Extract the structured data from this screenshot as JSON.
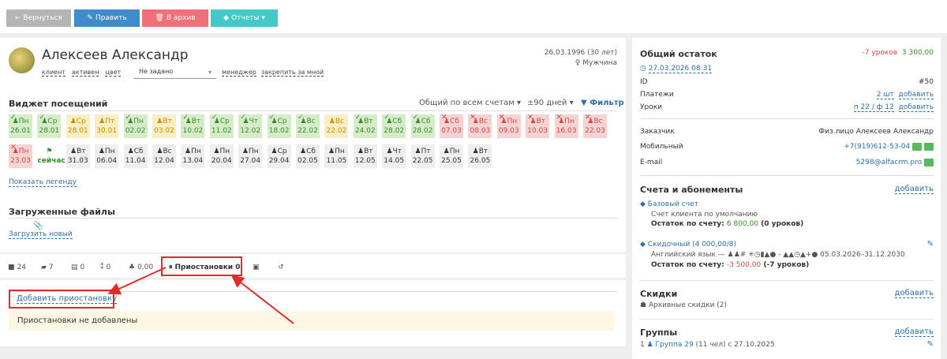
{
  "toolbar": {
    "back": "← Вернуться",
    "edit": "Править",
    "archive": "В архив",
    "reports": "Отчеты ▾"
  },
  "student": {
    "name": "Алексеев Александр",
    "birth": "26.03.1996 (30 лет)",
    "gender": "Мужчина",
    "tags": [
      "клиент",
      "активен",
      "цвет"
    ],
    "color_select": "Не задано",
    "manager": "менеджер",
    "pin": "закрепить за мной"
  },
  "visits": {
    "title": "Виджет посещений",
    "scope": "Общий по всем счетам ▾",
    "range": "±90 дней ▾",
    "filter": "Фильтр",
    "row1": [
      {
        "w": "Пн",
        "d": "26.01",
        "s": "g"
      },
      {
        "w": "Ср",
        "d": "28.01",
        "s": "g"
      },
      {
        "w": "Ср",
        "d": "28.01",
        "s": "y"
      },
      {
        "w": "Пт",
        "d": "30.01",
        "s": "y"
      },
      {
        "w": "Пн",
        "d": "02.02",
        "s": "g"
      },
      {
        "w": "Вт",
        "d": "03.02",
        "s": "y"
      },
      {
        "w": "Вт",
        "d": "10.02",
        "s": "g"
      },
      {
        "w": "Ср",
        "d": "11.02",
        "s": "g"
      },
      {
        "w": "Чт",
        "d": "12.02",
        "s": "g"
      },
      {
        "w": "Ср",
        "d": "18.02",
        "s": "g"
      },
      {
        "w": "Вс",
        "d": "22.02",
        "s": "g"
      },
      {
        "w": "Вс",
        "d": "22.02",
        "s": "y"
      },
      {
        "w": "Вт",
        "d": "24.02",
        "s": "g"
      },
      {
        "w": "Сб",
        "d": "28.02",
        "s": "g"
      },
      {
        "w": "Сб",
        "d": "28.02",
        "s": "g"
      },
      {
        "w": "Сб",
        "d": "07.03",
        "s": "r"
      },
      {
        "w": "Вс",
        "d": "08.03",
        "s": "r"
      },
      {
        "w": "Пн",
        "d": "09.03",
        "s": "r"
      },
      {
        "w": "Вт",
        "d": "10.03",
        "s": "r"
      },
      {
        "w": "Пн",
        "d": "16.03",
        "s": "r"
      },
      {
        "w": "Вс",
        "d": "22.03",
        "s": "r"
      }
    ],
    "row2": [
      {
        "w": "Пн",
        "d": "23.03",
        "s": "r"
      },
      {
        "w": "",
        "d": "сейчас",
        "s": "now"
      },
      {
        "w": "Вт",
        "d": "31.03",
        "s": "n"
      },
      {
        "w": "Пн",
        "d": "06.04",
        "s": "n"
      },
      {
        "w": "Сб",
        "d": "11.04",
        "s": "n"
      },
      {
        "w": "Вс",
        "d": "12.04",
        "s": "n"
      },
      {
        "w": "Пн",
        "d": "13.04",
        "s": "n"
      },
      {
        "w": "Пн",
        "d": "20.04",
        "s": "n"
      },
      {
        "w": "Пн",
        "d": "27.04",
        "s": "n"
      },
      {
        "w": "Ср",
        "d": "29.04",
        "s": "n"
      },
      {
        "w": "Сб",
        "d": "02.05",
        "s": "n"
      },
      {
        "w": "Пн",
        "d": "11.05",
        "s": "n"
      },
      {
        "w": "Вт",
        "d": "12.05",
        "s": "n"
      },
      {
        "w": "Чт",
        "d": "14.05",
        "s": "n"
      },
      {
        "w": "Пт",
        "d": "22.05",
        "s": "n"
      },
      {
        "w": "Пн",
        "d": "25.05",
        "s": "n"
      },
      {
        "w": "Вт",
        "d": "26.05",
        "s": "n"
      }
    ],
    "legend": "Показать легенду"
  },
  "files": {
    "title": "Загруженные файлы",
    "upload": "Загрузить новый"
  },
  "tabs": {
    "t1": "24",
    "t2": "7",
    "t3": "0",
    "t4": "0",
    "t5": "0,00",
    "pauses": "Приостановки 0"
  },
  "pauses": {
    "add": "Добавить приостановку",
    "empty": "Приостановки не добавлены"
  },
  "right": {
    "balance_title": "Общий остаток",
    "balance_lessons": "-7 уроков",
    "balance_money": "3 300,00",
    "balance_date": "27.03.2026 08:31",
    "id_label": "ID",
    "id_value": "#50",
    "payments_label": "Платежи",
    "payments_value": "2 шт",
    "add": "добавить",
    "lessons_label": "Уроки",
    "lessons_value": "п 22 / ф 12",
    "customer_label": "Заказчик",
    "customer_value": "Физ.лицо Алексеев Александр",
    "mobile_label": "Мобильный",
    "mobile_value": "+7(919)612-53-04",
    "email_label": "E-mail",
    "email_value": "5298@alfacrm.pro",
    "accounts_title": "Счета и абонементы",
    "base_account": "Базовый счет",
    "base_desc": "Счет клиента по умолчанию",
    "base_balance_label": "Остаток по счету:",
    "base_balance_value": "6 800,00",
    "base_balance_lessons": "(0 уроков)",
    "discount_account": "Скидочный (4 000,00/8)",
    "discount_desc": "Английский язык —",
    "discount_dates": "05.03.2026–31.12.2030",
    "discount_balance_label": "Остаток по счету:",
    "discount_balance_value": "-3 500,00",
    "discount_balance_lessons": "(-7 уроков)",
    "discounts_title": "Скидки",
    "discounts_archive": "Архивные скидки (2)",
    "groups_title": "Группы",
    "group_num": "1",
    "group_link": "Группа 29",
    "group_info": "(11 чел) с 27.10.2025"
  },
  "colors": {
    "grey": "#b5b5b5",
    "blue": "#428bca",
    "red": "#f0707a",
    "teal": "#45c8c8",
    "green": "#5cb85c"
  }
}
